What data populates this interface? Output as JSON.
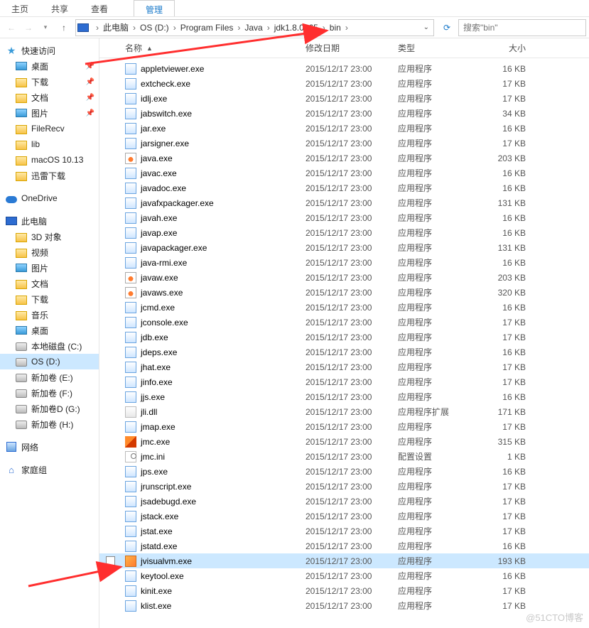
{
  "ribbon": {
    "home": "主页",
    "share": "共享",
    "view": "查看",
    "manage": "管理"
  },
  "breadcrumb": {
    "pc": "此电脑",
    "items": [
      "OS (D:)",
      "Program Files",
      "Java",
      "jdk1.8.0_65",
      "bin"
    ]
  },
  "search": {
    "placeholder": "搜索\"bin\""
  },
  "columns": {
    "name": "名称",
    "date": "修改日期",
    "type": "类型",
    "size": "大小"
  },
  "sidebar": {
    "quick": "快速访问",
    "quick_items": [
      {
        "label": "桌面",
        "icon": "img",
        "pin": true
      },
      {
        "label": "下载",
        "icon": "folder",
        "pin": true
      },
      {
        "label": "文档",
        "icon": "folder",
        "pin": true
      },
      {
        "label": "图片",
        "icon": "img",
        "pin": true
      },
      {
        "label": "FileRecv",
        "icon": "folder",
        "pin": false
      },
      {
        "label": "lib",
        "icon": "folder",
        "pin": false
      },
      {
        "label": "macOS 10.13",
        "icon": "folder",
        "pin": false
      },
      {
        "label": "迅雷下载",
        "icon": "folder",
        "pin": false
      }
    ],
    "onedrive": "OneDrive",
    "thispc": "此电脑",
    "pc_items": [
      {
        "label": "3D 对象",
        "icon": "folder"
      },
      {
        "label": "视频",
        "icon": "folder"
      },
      {
        "label": "图片",
        "icon": "img"
      },
      {
        "label": "文档",
        "icon": "folder"
      },
      {
        "label": "下载",
        "icon": "folder"
      },
      {
        "label": "音乐",
        "icon": "folder"
      },
      {
        "label": "桌面",
        "icon": "img"
      },
      {
        "label": "本地磁盘 (C:)",
        "icon": "disk"
      },
      {
        "label": "OS (D:)",
        "icon": "disk",
        "selected": true
      },
      {
        "label": "新加卷 (E:)",
        "icon": "disk"
      },
      {
        "label": "新加卷 (F:)",
        "icon": "disk"
      },
      {
        "label": "新加卷D (G:)",
        "icon": "disk"
      },
      {
        "label": "新加卷 (H:)",
        "icon": "disk"
      }
    ],
    "network": "网络",
    "homegroup": "家庭组"
  },
  "files": [
    {
      "name": "appletviewer.exe",
      "date": "2015/12/17 23:00",
      "type": "应用程序",
      "size": "16 KB",
      "icon": "exe"
    },
    {
      "name": "extcheck.exe",
      "date": "2015/12/17 23:00",
      "type": "应用程序",
      "size": "17 KB",
      "icon": "exe"
    },
    {
      "name": "idlj.exe",
      "date": "2015/12/17 23:00",
      "type": "应用程序",
      "size": "17 KB",
      "icon": "exe"
    },
    {
      "name": "jabswitch.exe",
      "date": "2015/12/17 23:00",
      "type": "应用程序",
      "size": "34 KB",
      "icon": "exe"
    },
    {
      "name": "jar.exe",
      "date": "2015/12/17 23:00",
      "type": "应用程序",
      "size": "16 KB",
      "icon": "exe"
    },
    {
      "name": "jarsigner.exe",
      "date": "2015/12/17 23:00",
      "type": "应用程序",
      "size": "17 KB",
      "icon": "exe"
    },
    {
      "name": "java.exe",
      "date": "2015/12/17 23:00",
      "type": "应用程序",
      "size": "203 KB",
      "icon": "java"
    },
    {
      "name": "javac.exe",
      "date": "2015/12/17 23:00",
      "type": "应用程序",
      "size": "16 KB",
      "icon": "exe"
    },
    {
      "name": "javadoc.exe",
      "date": "2015/12/17 23:00",
      "type": "应用程序",
      "size": "16 KB",
      "icon": "exe"
    },
    {
      "name": "javafxpackager.exe",
      "date": "2015/12/17 23:00",
      "type": "应用程序",
      "size": "131 KB",
      "icon": "exe"
    },
    {
      "name": "javah.exe",
      "date": "2015/12/17 23:00",
      "type": "应用程序",
      "size": "16 KB",
      "icon": "exe"
    },
    {
      "name": "javap.exe",
      "date": "2015/12/17 23:00",
      "type": "应用程序",
      "size": "16 KB",
      "icon": "exe"
    },
    {
      "name": "javapackager.exe",
      "date": "2015/12/17 23:00",
      "type": "应用程序",
      "size": "131 KB",
      "icon": "exe"
    },
    {
      "name": "java-rmi.exe",
      "date": "2015/12/17 23:00",
      "type": "应用程序",
      "size": "16 KB",
      "icon": "exe"
    },
    {
      "name": "javaw.exe",
      "date": "2015/12/17 23:00",
      "type": "应用程序",
      "size": "203 KB",
      "icon": "java"
    },
    {
      "name": "javaws.exe",
      "date": "2015/12/17 23:00",
      "type": "应用程序",
      "size": "320 KB",
      "icon": "java"
    },
    {
      "name": "jcmd.exe",
      "date": "2015/12/17 23:00",
      "type": "应用程序",
      "size": "16 KB",
      "icon": "exe"
    },
    {
      "name": "jconsole.exe",
      "date": "2015/12/17 23:00",
      "type": "应用程序",
      "size": "17 KB",
      "icon": "exe"
    },
    {
      "name": "jdb.exe",
      "date": "2015/12/17 23:00",
      "type": "应用程序",
      "size": "17 KB",
      "icon": "exe"
    },
    {
      "name": "jdeps.exe",
      "date": "2015/12/17 23:00",
      "type": "应用程序",
      "size": "16 KB",
      "icon": "exe"
    },
    {
      "name": "jhat.exe",
      "date": "2015/12/17 23:00",
      "type": "应用程序",
      "size": "17 KB",
      "icon": "exe"
    },
    {
      "name": "jinfo.exe",
      "date": "2015/12/17 23:00",
      "type": "应用程序",
      "size": "17 KB",
      "icon": "exe"
    },
    {
      "name": "jjs.exe",
      "date": "2015/12/17 23:00",
      "type": "应用程序",
      "size": "16 KB",
      "icon": "exe"
    },
    {
      "name": "jli.dll",
      "date": "2015/12/17 23:00",
      "type": "应用程序扩展",
      "size": "171 KB",
      "icon": "dll"
    },
    {
      "name": "jmap.exe",
      "date": "2015/12/17 23:00",
      "type": "应用程序",
      "size": "17 KB",
      "icon": "exe"
    },
    {
      "name": "jmc.exe",
      "date": "2015/12/17 23:00",
      "type": "应用程序",
      "size": "315 KB",
      "icon": "jmc"
    },
    {
      "name": "jmc.ini",
      "date": "2015/12/17 23:00",
      "type": "配置设置",
      "size": "1 KB",
      "icon": "ini"
    },
    {
      "name": "jps.exe",
      "date": "2015/12/17 23:00",
      "type": "应用程序",
      "size": "16 KB",
      "icon": "exe"
    },
    {
      "name": "jrunscript.exe",
      "date": "2015/12/17 23:00",
      "type": "应用程序",
      "size": "17 KB",
      "icon": "exe"
    },
    {
      "name": "jsadebugd.exe",
      "date": "2015/12/17 23:00",
      "type": "应用程序",
      "size": "17 KB",
      "icon": "exe"
    },
    {
      "name": "jstack.exe",
      "date": "2015/12/17 23:00",
      "type": "应用程序",
      "size": "17 KB",
      "icon": "exe"
    },
    {
      "name": "jstat.exe",
      "date": "2015/12/17 23:00",
      "type": "应用程序",
      "size": "17 KB",
      "icon": "exe"
    },
    {
      "name": "jstatd.exe",
      "date": "2015/12/17 23:00",
      "type": "应用程序",
      "size": "16 KB",
      "icon": "exe"
    },
    {
      "name": "jvisualvm.exe",
      "date": "2015/12/17 23:00",
      "type": "应用程序",
      "size": "193 KB",
      "icon": "jv",
      "selected": true
    },
    {
      "name": "keytool.exe",
      "date": "2015/12/17 23:00",
      "type": "应用程序",
      "size": "16 KB",
      "icon": "exe"
    },
    {
      "name": "kinit.exe",
      "date": "2015/12/17 23:00",
      "type": "应用程序",
      "size": "17 KB",
      "icon": "exe"
    },
    {
      "name": "klist.exe",
      "date": "2015/12/17 23:00",
      "type": "应用程序",
      "size": "17 KB",
      "icon": "exe"
    }
  ],
  "watermark": "@51CTO博客"
}
